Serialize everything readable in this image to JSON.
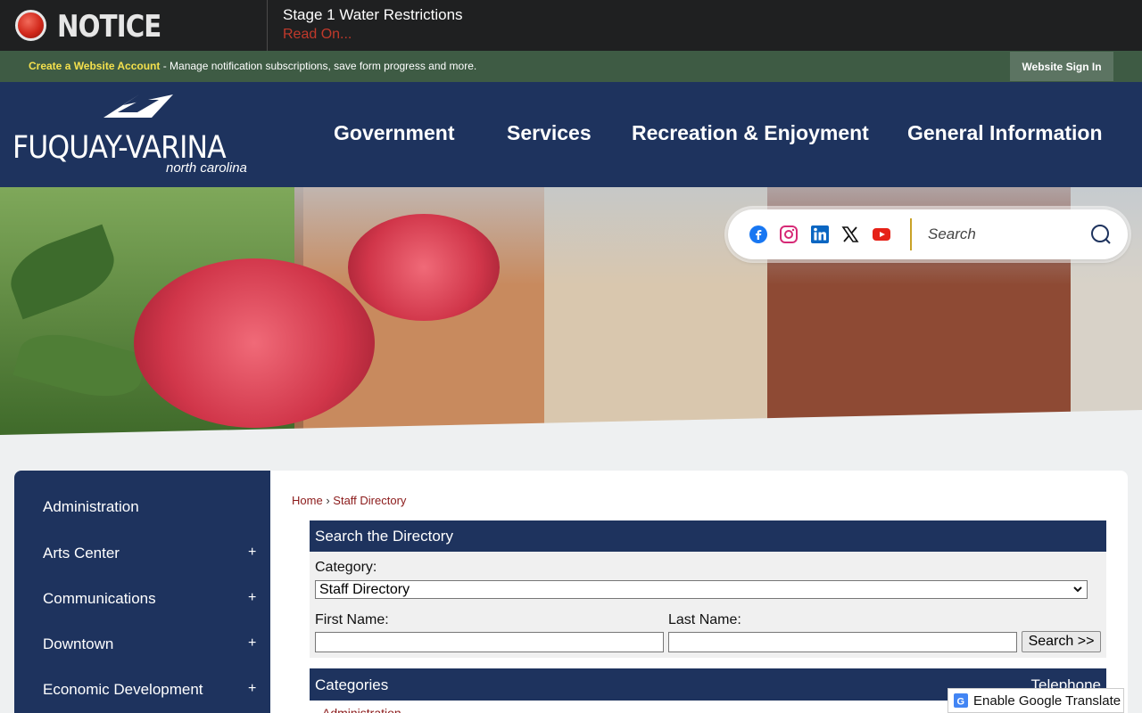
{
  "notice": {
    "title": "NOTICE",
    "headline": "Stage 1 Water Restrictions",
    "link": "Read On..."
  },
  "account_bar": {
    "create_link": "Create a Website Account",
    "description": " - Manage notification subscriptions, save form progress and more.",
    "sign_in": "Website Sign In"
  },
  "logo": {
    "name": "FUQUAY-VARINA",
    "subtitle": "north carolina"
  },
  "nav": {
    "items": [
      "Government",
      "Services",
      "Recreation & Enjoyment",
      "General Information"
    ]
  },
  "social": {
    "icons": [
      "facebook-icon",
      "instagram-icon",
      "linkedin-icon",
      "x-icon",
      "youtube-icon"
    ],
    "search_placeholder": "Search"
  },
  "sidebar": {
    "items": [
      {
        "label": "Administration",
        "expandable": false
      },
      {
        "label": "Arts Center",
        "expandable": true
      },
      {
        "label": "Communications",
        "expandable": true
      },
      {
        "label": "Downtown",
        "expandable": true
      },
      {
        "label": "Economic Development",
        "expandable": true
      }
    ],
    "expand_symbol": "+"
  },
  "breadcrumb": {
    "home": "Home",
    "separator": "›",
    "current": "Staff Directory"
  },
  "directory_search": {
    "heading": "Search the Directory",
    "category_label": "Category:",
    "category_value": "Staff Directory",
    "first_name_label": "First Name:",
    "last_name_label": "Last Name:",
    "first_name_value": "",
    "last_name_value": "",
    "search_button": "Search >>"
  },
  "categories": {
    "heading": "Categories",
    "telephone_heading": "Telephone",
    "first_row": "Administration"
  },
  "translate": {
    "label": "Enable Google Translate"
  },
  "colors": {
    "navy": "#1e335e",
    "account_green": "#3e5b44",
    "notice_bg": "#1f2021",
    "link_red": "#8b1a1a",
    "accent_yellow": "#f4e04d"
  }
}
